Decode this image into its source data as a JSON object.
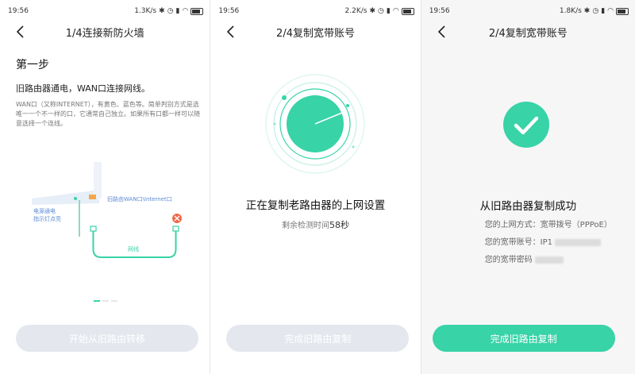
{
  "screens": [
    {
      "status": {
        "time": "19:56",
        "speed": "1.3K/s"
      },
      "title": "1/4连接新防火墙",
      "step_title": "第一步",
      "step_desc": "旧路由器通电，WAN口连接网线。",
      "step_note": "WAN口（又称INTERNET），有黄色、蓝色等。简单判别方式是选唯一一个不一样的口，它通常自己独立。如果所有口都一样可以随意选择一个连线。",
      "illus": {
        "wan_label": "旧路由WAN口\\Internet口",
        "power_label_1": "电源通电",
        "power_label_2": "指示灯点亮",
        "cable_label": "网线"
      },
      "button": "开始从旧路由转移"
    },
    {
      "status": {
        "time": "19:56",
        "speed": "2.2K/s"
      },
      "title": "2/4复制宽带账号",
      "main_text": "正在复制老路由器的上网设置",
      "sub_prefix": "剩余检测时间",
      "seconds": "58秒",
      "button": "完成旧路由复制"
    },
    {
      "status": {
        "time": "19:56",
        "speed": "1.8K/s"
      },
      "title": "2/4复制宽带账号",
      "success": "从旧路由器复制成功",
      "mode_line": "您的上网方式：宽带拨号（PPPoE）",
      "account_line": "您的宽带账号：IP1",
      "password_line": "您的宽带密码",
      "button": "完成旧路由复制"
    }
  ],
  "colors": {
    "accent": "#38d3a7",
    "disabled": "#e4e8ee",
    "error": "#f06a4a"
  },
  "icons": [
    "back-chevron-icon",
    "bluetooth-icon",
    "alarm-icon",
    "signal-icon",
    "wifi-icon",
    "battery-icon",
    "close-icon",
    "check-icon"
  ]
}
